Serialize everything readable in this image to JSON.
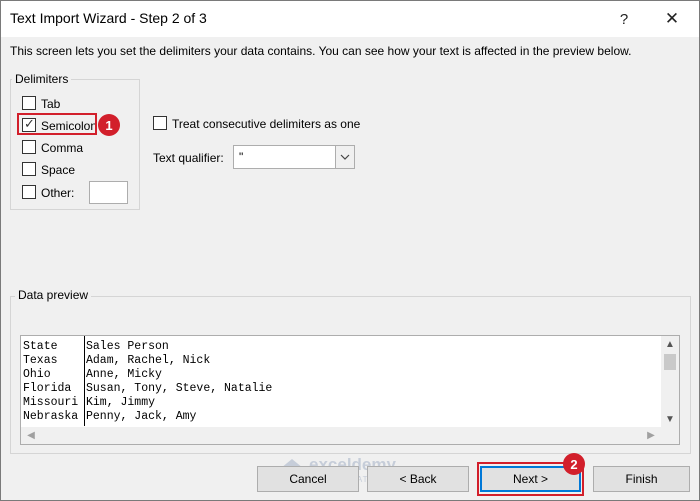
{
  "window": {
    "title": "Text Import Wizard - Step 2 of 3",
    "help_glyph": "?",
    "close_glyph": "✕"
  },
  "intro_text": "This screen lets you set the delimiters your data contains.  You can see how your text is affected in the preview below.",
  "delimiters": {
    "label": "Delimiters",
    "items": [
      {
        "label": "Tab",
        "checked": false
      },
      {
        "label": "Semicolon",
        "checked": true
      },
      {
        "label": "Comma",
        "checked": false
      },
      {
        "label": "Space",
        "checked": false
      },
      {
        "label": "Other:",
        "checked": false
      }
    ],
    "other_value": ""
  },
  "options": {
    "treat_consecutive": {
      "label": "Treat consecutive delimiters as one",
      "checked": false
    },
    "text_qualifier": {
      "label": "Text qualifier:",
      "value": "\""
    }
  },
  "preview": {
    "label": "Data preview",
    "rows": [
      [
        "State",
        "Sales Person"
      ],
      [
        "Texas",
        "Adam, Rachel, Nick"
      ],
      [
        "Ohio",
        "Anne, Micky"
      ],
      [
        "Florida",
        "Susan, Tony, Steve, Natalie"
      ],
      [
        "Missouri",
        "Kim, Jimmy"
      ],
      [
        "Nebraska",
        "Penny, Jack, Amy"
      ]
    ]
  },
  "buttons": {
    "cancel": "Cancel",
    "back": "< Back",
    "next": "Next >",
    "finish": "Finish"
  },
  "annotations": {
    "badge_1": "1",
    "badge_2": "2",
    "color": "#d21f2b"
  },
  "watermark": {
    "name": "exceldemy",
    "tagline": "EXCEL · DATA · BI"
  },
  "colors": {
    "accent": "#0078d7",
    "annotation": "#d21f2b",
    "dialog_bg": "#f0f0f0"
  }
}
